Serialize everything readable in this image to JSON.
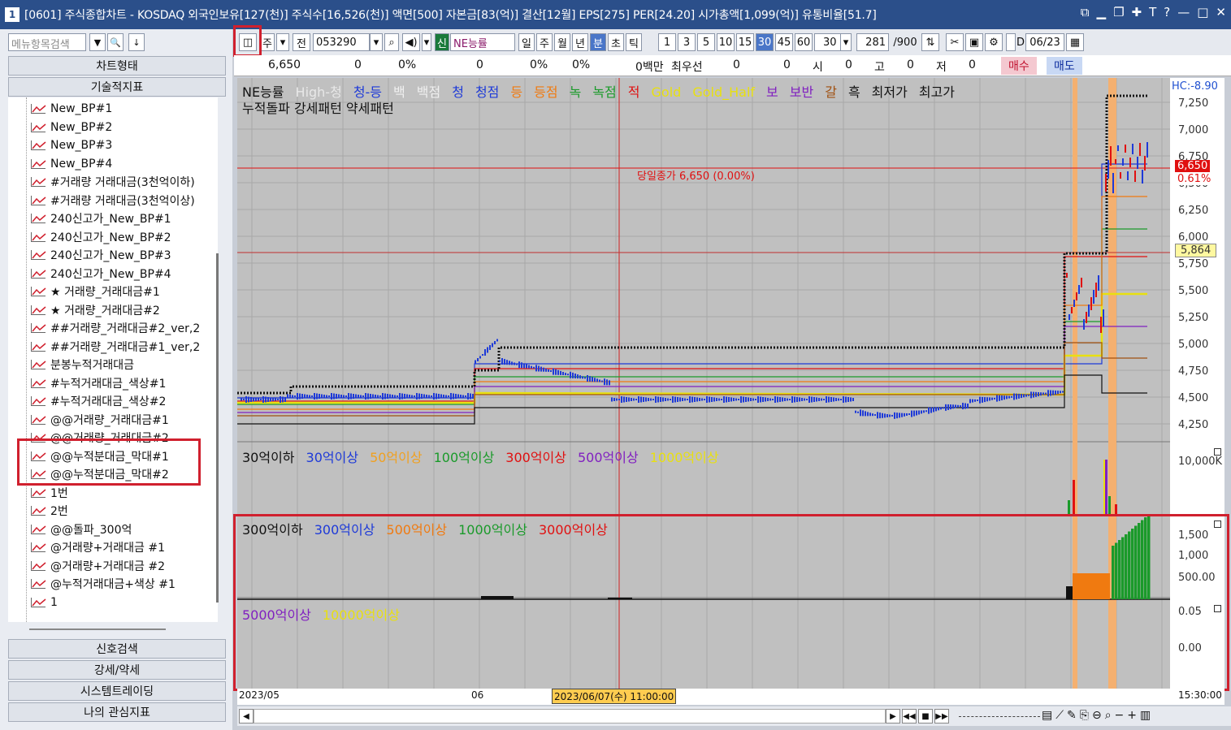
{
  "window": {
    "badge": "1",
    "title": "[0601] 주식종합차트 - KOSDAQ 외국인보유[127(천)] 주식수[16,526(천)] 액면[500] 자본금[83(억)] 결산[12월] EPS[275] PER[24.20] 시가총액[1,099(억)] 유통비율[51.7]"
  },
  "left": {
    "search_placeholder": "메뉴항목검색",
    "btn_chart_type": "차트형태",
    "btn_tech": "기술적지표",
    "items": [
      "New_BP#1",
      "New_BP#2",
      "New_BP#3",
      "New_BP#4",
      "#거래량 거래대금(3천억이하)",
      "#거래량 거래대금(3천억이상)",
      "240신고가_New_BP#1",
      "240신고가_New_BP#2",
      "240신고가_New_BP#3",
      "240신고가_New_BP#4",
      "★ 거래량_거래대금#1",
      "★ 거래량_거래대금#2",
      "##거래량_거래대금#2_ver,2",
      "##거래량_거래대금#1_ver,2",
      "분봉누적거래대금",
      "#누적거래대금_색상#1",
      "#누적거래대금_색상#2",
      "@@거래량_거래대금#1",
      "@@거래량_거래대금#2",
      "@@누적분대금_막대#1",
      "@@누적분대금_막대#2",
      "1번",
      "2번",
      "@@돌파_300억",
      "@거래량+거래대금 #1",
      "@거래량+거래대금 #2",
      "@누적거래대금+색상 #1",
      "1"
    ],
    "btn_signal": "신호검색",
    "btn_strength": "강세/약세",
    "btn_systrade": "시스템트레이딩",
    "btn_myindicator": "나의 관심지표"
  },
  "toolbar": {
    "ju": "주",
    "jeon": "전",
    "code": "053290",
    "stock": "NE능률",
    "sin": "신",
    "periods": [
      "일",
      "주",
      "월",
      "년",
      "분",
      "초",
      "틱"
    ],
    "mins": [
      "1",
      "3",
      "5",
      "10",
      "15",
      "30",
      "45",
      "60"
    ],
    "interval": "30",
    "count": "281",
    "count_total": "/900",
    "date": "06/23",
    "d": "D"
  },
  "info": {
    "price": "6,650",
    "chg": "0",
    "pct": "0%",
    "v1": "0",
    "p2": "0%",
    "p3": "0%",
    "amt": "0백만",
    "best": "최우선",
    "b1": "0",
    "b2": "0",
    "si": "시",
    "siv": "0",
    "go": "고",
    "gov": "0",
    "jeo": "저",
    "jeov": "0",
    "buy": "매수",
    "sell": "매도"
  },
  "legend1": [
    [
      "NE능률",
      "#111"
    ],
    [
      "High-청",
      "#e8e8e8"
    ],
    [
      "청-등",
      "#1e3ad8"
    ],
    [
      "백",
      "#f0f0f0"
    ],
    [
      "백점",
      "#f0f0f0"
    ],
    [
      "청",
      "#1e3ad8"
    ],
    [
      "청점",
      "#1e3ad8"
    ],
    [
      "등",
      "#f07a10"
    ],
    [
      "등점",
      "#f07a10"
    ],
    [
      "녹",
      "#1a9a2a"
    ],
    [
      "녹점",
      "#1a9a2a"
    ],
    [
      "적",
      "#e01010"
    ],
    [
      "Gold",
      "#e8e010"
    ],
    [
      "Gold_Half",
      "#e8e010"
    ],
    [
      "보",
      "#8020c0"
    ],
    [
      "보반",
      "#8020c0"
    ],
    [
      "갈",
      "#a05010"
    ],
    [
      "흑",
      "#111"
    ],
    [
      "최저가",
      "#111"
    ],
    [
      "최고가",
      "#111"
    ]
  ],
  "legend1b": "누적돌파 강세패턴  약세패턴",
  "close_label": "당일종가 6,650 (0.00%)",
  "legend2": [
    [
      "30억이하",
      "#111"
    ],
    [
      "30억이상",
      "#1e3ad8"
    ],
    [
      "50억이상",
      "#f0a020"
    ],
    [
      "100억이상",
      "#1a9a2a"
    ],
    [
      "300억이상",
      "#e01010"
    ],
    [
      "500억이상",
      "#8020c0"
    ],
    [
      "1000억이상",
      "#e8e010"
    ]
  ],
  "legend3": [
    [
      "300억이하",
      "#111"
    ],
    [
      "300억이상",
      "#1e3ad8"
    ],
    [
      "500억이상",
      "#f07a10"
    ],
    [
      "1000억이상",
      "#1a9a2a"
    ],
    [
      "3000억이상",
      "#e01010"
    ]
  ],
  "legend4": [
    [
      "5000억이상",
      "#8020c0"
    ],
    [
      "10000억이상",
      "#e8e010"
    ]
  ],
  "yaxis": {
    "hc": "HC:-8.90",
    "prices": [
      "7,250",
      "7,000",
      "6,750",
      "6,500",
      "6,250",
      "6,000",
      "5,750",
      "5,500",
      "5,250",
      "5,000",
      "4,750",
      "4,500",
      "4,250"
    ],
    "cur_price": "6,650",
    "cur_pct": "0.61%",
    "marker": "5,864",
    "vol": "10,000K",
    "amt": [
      "1,500",
      "1,000",
      "500.00"
    ],
    "osc": [
      "0.05",
      "0.00"
    ]
  },
  "xaxis": {
    "start": "2023/05",
    "mid": "06",
    "cursor": "2023/06/07(수) 11:00:00",
    "end": "15:30:00"
  },
  "colors": {
    "title_bg": "#2b4f8a",
    "highlight": "#d0202e",
    "chart_bg": "#c0c0c0"
  }
}
